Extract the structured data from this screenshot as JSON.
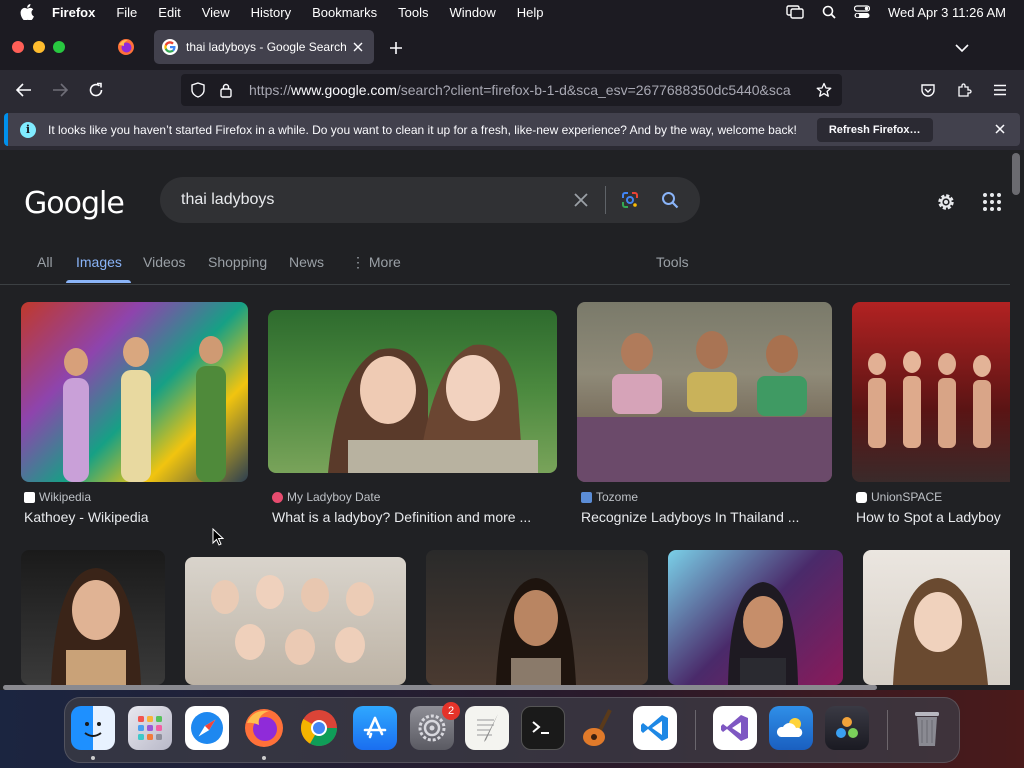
{
  "menubar": {
    "app_name": "Firefox",
    "items": [
      "File",
      "Edit",
      "View",
      "History",
      "Bookmarks",
      "Tools",
      "Window",
      "Help"
    ],
    "datetime": "Wed Apr 3  11:26 AM"
  },
  "tabs": {
    "active_title": "thai ladyboys - Google Search"
  },
  "urlbar": {
    "scheme": "https://",
    "host": "www.google.com",
    "path": "/search?client=firefox-b-1-d&sca_esv=2677688350dc5440&sca"
  },
  "notice": {
    "message": "It looks like you haven’t started Firefox in a while. Do you want to clean it up for a fresh, like-new experience? And by the way, welcome back!",
    "button": "Refresh Firefox…"
  },
  "google": {
    "logo": "Google",
    "query": "thai ladyboys",
    "tabs": [
      {
        "label": "All"
      },
      {
        "label": "Images"
      },
      {
        "label": "Videos"
      },
      {
        "label": "Shopping"
      },
      {
        "label": "News"
      },
      {
        "label": "⋮  More"
      }
    ],
    "tools_label": "Tools",
    "results": [
      {
        "source": "Wikipedia",
        "title": "Kathoey - Wikipedia"
      },
      {
        "source": "My Ladyboy Date",
        "title": "What is a ladyboy? Definition and more ..."
      },
      {
        "source": "Tozome",
        "title": "Recognize Ladyboys In Thailand ..."
      },
      {
        "source": "UnionSPACE",
        "title": "How to Spot a Ladyboy"
      }
    ]
  },
  "dock": {
    "settings_badge": "2"
  },
  "colors": {
    "accent": "#8ab4f8",
    "page_bg": "#202124",
    "toolbar_bg": "#2b2a33",
    "tabstrip_bg": "#1c1b22"
  }
}
